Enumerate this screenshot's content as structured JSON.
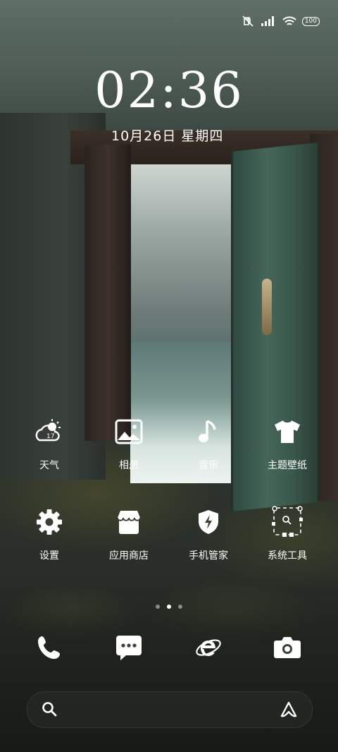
{
  "status_bar": {
    "icons": [
      "mute-icon",
      "signal-icon",
      "wifi-icon"
    ],
    "battery": "100"
  },
  "lock": {
    "time": "02:36",
    "date": "10月26日  星期四"
  },
  "apps_row1": [
    {
      "label": "天气",
      "icon": "weather-icon",
      "badge": "17"
    },
    {
      "label": "相册",
      "icon": "gallery-icon"
    },
    {
      "label": "音乐",
      "icon": "music-icon"
    },
    {
      "label": "主题壁纸",
      "icon": "themes-icon"
    }
  ],
  "apps_row2": [
    {
      "label": "设置",
      "icon": "settings-gear-icon"
    },
    {
      "label": "应用商店",
      "icon": "app-store-icon"
    },
    {
      "label": "手机管家",
      "icon": "security-shield-icon"
    },
    {
      "label": "系统工具",
      "icon": "system-tools-folder-icon"
    }
  ],
  "page_indicator": {
    "pages": 3,
    "active": 1
  },
  "dock": [
    {
      "icon": "phone-icon"
    },
    {
      "icon": "messages-icon"
    },
    {
      "icon": "browser-icon"
    },
    {
      "icon": "camera-icon"
    }
  ],
  "search_bar": {
    "left_icon": "search-icon",
    "right_icon": "ai-assistant-icon"
  },
  "colors": {
    "text": "#ffffff"
  }
}
